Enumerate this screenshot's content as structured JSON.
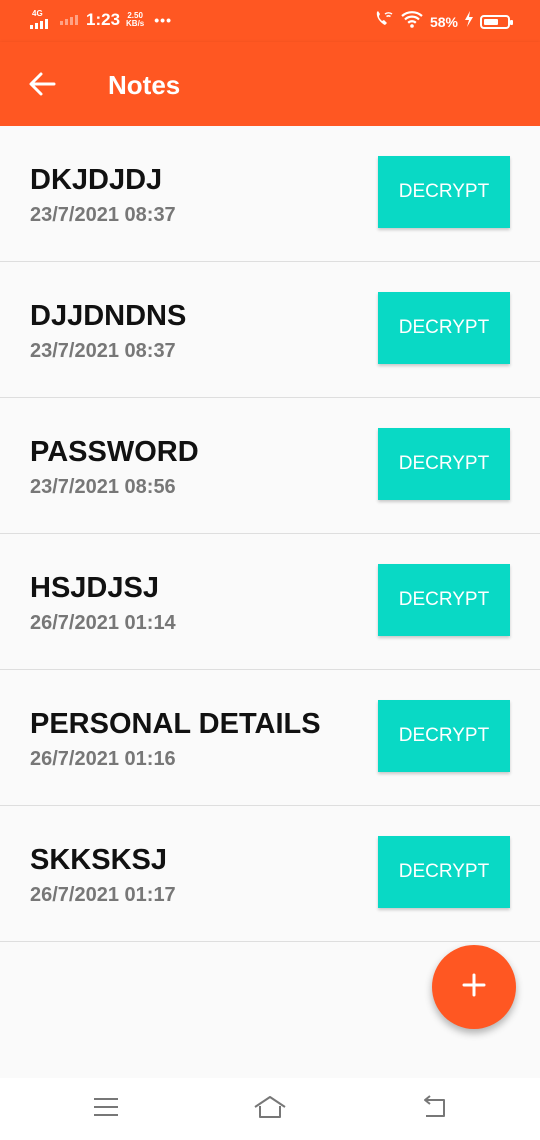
{
  "status_bar": {
    "network": "4G",
    "time": "1:23",
    "speed_value": "2.50",
    "speed_unit": "KB/s",
    "more": "•••",
    "battery_percent": "58%",
    "icons": [
      "signal-icon",
      "wifi-calling-icon",
      "wifi-icon",
      "charging-icon",
      "battery-icon"
    ]
  },
  "app_bar": {
    "title": "Notes",
    "back_icon": "arrow-left-icon"
  },
  "notes": [
    {
      "name": "DKJDJDJ",
      "date": "23/7/2021 08:37",
      "action": "DECRYPT"
    },
    {
      "name": "DJJDNDNS",
      "date": "23/7/2021 08:37",
      "action": "DECRYPT"
    },
    {
      "name": "PASSWORD",
      "date": "23/7/2021 08:56",
      "action": "DECRYPT"
    },
    {
      "name": "HSJDJSJ",
      "date": "26/7/2021 01:14",
      "action": "DECRYPT"
    },
    {
      "name": "PERSONAL DETAILS",
      "date": "26/7/2021 01:16",
      "action": "DECRYPT"
    },
    {
      "name": "SKKSKSJ",
      "date": "26/7/2021 01:17",
      "action": "DECRYPT"
    }
  ],
  "fab": {
    "icon": "plus-icon"
  },
  "nav_bar": {
    "icons": [
      "menu-icon",
      "home-icon",
      "back-icon"
    ]
  },
  "colors": {
    "primary": "#ff5722",
    "accent": "#09d9c5",
    "background": "#fafafa",
    "title_text": "#111111",
    "date_text": "#777777"
  }
}
